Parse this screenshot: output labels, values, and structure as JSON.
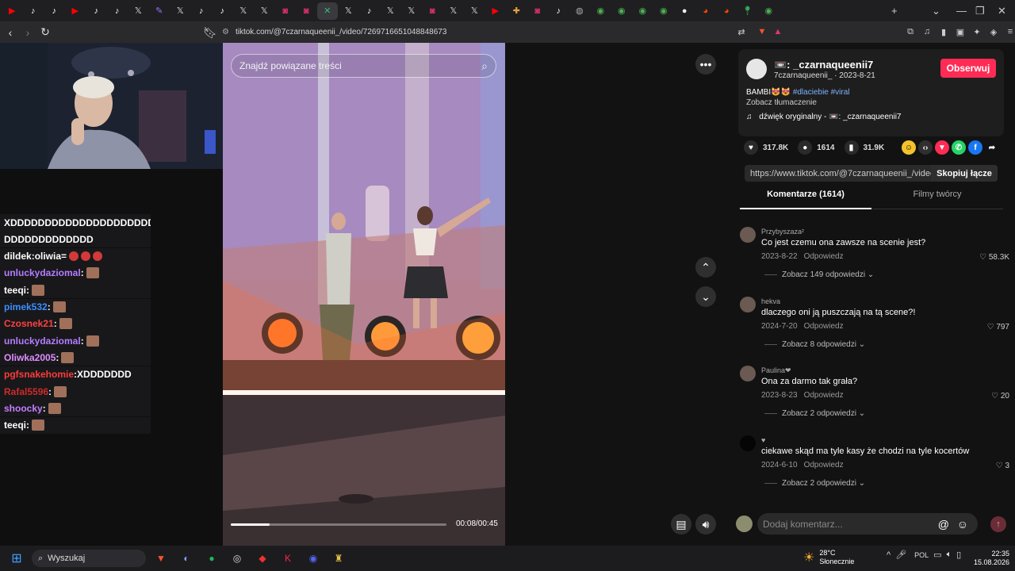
{
  "browser": {
    "tab_icons": [
      "youtube",
      "tiktok",
      "tiktok",
      "youtube",
      "tiktok",
      "tiktok",
      "x",
      "feather",
      "x",
      "tiktok",
      "tiktok",
      "x",
      "x",
      "instagram",
      "instagram",
      "flashcard",
      "x",
      "tiktok",
      "x",
      "x",
      "instagram",
      "x",
      "x",
      "youtube",
      "puzzle",
      "instagram",
      "tiktok",
      "globe",
      "chrome",
      "chrome",
      "chrome",
      "chrome",
      "circle",
      "reddit",
      "reddit",
      "maps",
      "chrome"
    ],
    "active_tab_index": 15,
    "active_tab_close": "✕",
    "new_tab": "+",
    "url": "tiktok.com/@7czarnaqueenii_/video/7269716651048848673"
  },
  "stream_chat": {
    "lines": [
      {
        "user": "XDDDDDDDDDDDDDDDDDDDDDDD",
        "sep": "",
        "msg": "",
        "color": "#ffffff",
        "emote": "none"
      },
      {
        "user": "DDDDDDDDDDDDD",
        "sep": "",
        "msg": "",
        "color": "#ffffff",
        "emote": "none"
      },
      {
        "user": "dildek",
        "sep": " : ",
        "msg": "oliwia=",
        "color": "#ffffff",
        "emote": "red"
      },
      {
        "user": "unluckydaziomal",
        "sep": " : ",
        "msg": "",
        "color": "#b57dff",
        "emote": "pic"
      },
      {
        "user": "teeqi",
        "sep": " : ",
        "msg": "",
        "color": "#ffffff",
        "emote": "pic"
      },
      {
        "user": "pimek532",
        "sep": " : ",
        "msg": "",
        "color": "#3a8fff",
        "emote": "pic"
      },
      {
        "user": "Czosnek21",
        "sep": " : ",
        "msg": "",
        "color": "#ff4040",
        "emote": "pic"
      },
      {
        "user": "unluckydaziomal",
        "sep": " : ",
        "msg": "",
        "color": "#b57dff",
        "emote": "pic"
      },
      {
        "user": "Oliwka2005",
        "sep": " : ",
        "msg": "",
        "color": "#e08cff",
        "emote": "pic"
      },
      {
        "user": "pgfsnakehomie",
        "sep": " : ",
        "msg": "XDDDDDDD",
        "color": "#ff3b3b",
        "emote": "none"
      },
      {
        "user": "Rafal5596",
        "sep": " : ",
        "msg": "",
        "color": "#cc2b2b",
        "emote": "pic"
      },
      {
        "user": "shoocky",
        "sep": " : ",
        "msg": "",
        "color": "#c77dff",
        "emote": "pic"
      },
      {
        "user": "teeqi",
        "sep": " : ",
        "msg": "",
        "color": "#ffffff",
        "emote": "pic"
      }
    ]
  },
  "video": {
    "search_placeholder": "Znajdź powiązane treści",
    "time": "00:08/00:45",
    "progress": 0.18
  },
  "post": {
    "username": "📼: _czarnaqueenii7",
    "handle_date": "7czarnaqueenii_ · 2023-8-21",
    "follow": "Obserwuj",
    "caption": "BAMBI😻😻",
    "hashtags": "#dlaciebie #viral",
    "translate": "Zobacz tłumaczenie",
    "music": "dźwięk oryginalny - 📼: _czarnaqueenii7",
    "likes": "317.8K",
    "comments": "1614",
    "saves": "31.9K",
    "link": "https://www.tiktok.com/@7czarnaqueenii_/video/7...",
    "copy": "Skopiuj łącze",
    "tab_comments": "Komentarze (1614)",
    "tab_creator": "Filmy twórcy"
  },
  "comments": [
    {
      "user": "Przybyszaza²",
      "text": "Co jest czemu ona zawsze na scenie jest?",
      "date": "2023-8-22",
      "reply": "Odpowiedz",
      "likes": "58.3K",
      "replies": "Zobacz 149 odpowiedzi"
    },
    {
      "user": "hekva",
      "text": "dlaczego oni ją puszczają na tą scene?!",
      "date": "2024-7-20",
      "reply": "Odpowiedz",
      "likes": "797",
      "replies": "Zobacz 8 odpowiedzi"
    },
    {
      "user": "Paulina❤",
      "text": "Ona za darmo tak grała?",
      "date": "2023-8-23",
      "reply": "Odpowiedz",
      "likes": "20",
      "replies": "Zobacz 2 odpowiedzi"
    },
    {
      "user": "♥",
      "text": "ciekawe skąd ma tyle kasy że chodzi na tyle kocertów",
      "date": "2024-6-10",
      "reply": "Odpowiedz",
      "likes": "3",
      "replies": "Zobacz 2 odpowiedzi"
    }
  ],
  "comment_input": "Dodaj komentarz...",
  "taskbar": {
    "search": "Wyszukaj",
    "temp": "28°C",
    "weather": "Słonecznie",
    "lang": "POL",
    "time": "22:35",
    "date": "15.08.2026"
  },
  "colors": {
    "accent": "#fe2c55"
  }
}
